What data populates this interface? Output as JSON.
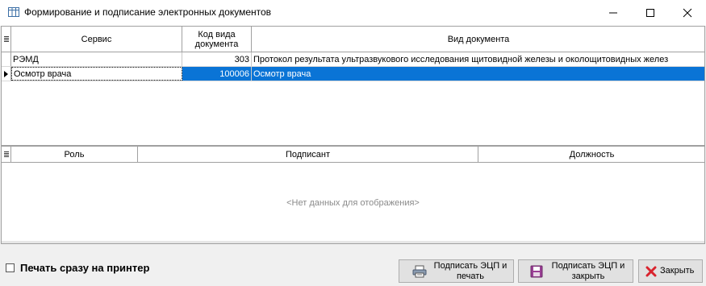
{
  "window": {
    "title": "Формирование и подписание электронных документов",
    "minimize": "—",
    "maximize": "☐",
    "close": "✕"
  },
  "documents_grid": {
    "columns": {
      "service": "Сервис",
      "doc_type_code": "Код вида документа",
      "doc_type": "Вид документа"
    },
    "rows": [
      {
        "service": "РЭМД",
        "code": "303",
        "type": "Протокол результата ультразвукового исследования щитовидной железы и околощитовидных желез",
        "selected": false
      },
      {
        "service": "Осмотр врача",
        "code": "100006",
        "type": "Осмотр врача",
        "selected": true
      }
    ]
  },
  "signers_grid": {
    "columns": {
      "role": "Роль",
      "signer": "Подписант",
      "position": "Должность"
    },
    "empty_text": "<Нет данных для отображения>"
  },
  "footer": {
    "print_checkbox_label": "Печать сразу на принтер",
    "print_checked": false,
    "sign_print_button": "Подписать ЭЦП и печать",
    "sign_close_button": "Подписать ЭЦП и закрыть",
    "close_button": "Закрыть"
  },
  "colors": {
    "selection": "#0a74d6",
    "border": "#a0a0a0",
    "close_icon": "#d9232d"
  }
}
